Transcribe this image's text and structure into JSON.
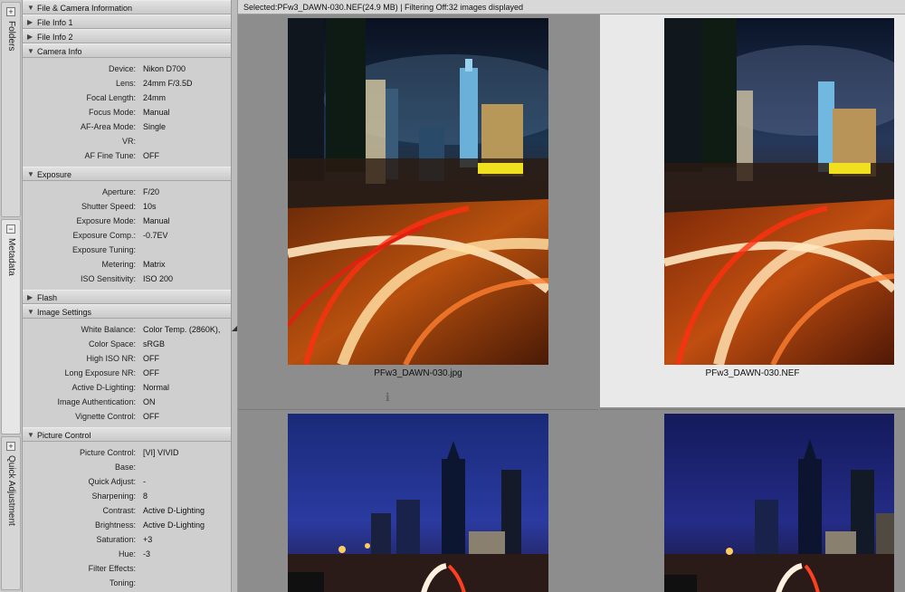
{
  "vtabs": {
    "folders": "Folders",
    "metadata": "Metadata",
    "quick_adjustment": "Quick Adjustment",
    "expand": "+",
    "collapse": "−"
  },
  "panel": {
    "file_camera": "File & Camera Information",
    "file_info_1": "File Info 1",
    "file_info_2": "File Info 2",
    "camera_info": {
      "title": "Camera Info",
      "rows": [
        {
          "k": "Device:",
          "v": "Nikon D700"
        },
        {
          "k": "Lens:",
          "v": "24mm F/3.5D"
        },
        {
          "k": "Focal Length:",
          "v": "24mm"
        },
        {
          "k": "Focus Mode:",
          "v": "Manual"
        },
        {
          "k": "AF-Area Mode:",
          "v": "Single"
        },
        {
          "k": "VR:",
          "v": ""
        },
        {
          "k": "AF Fine Tune:",
          "v": "OFF"
        }
      ]
    },
    "exposure": {
      "title": "Exposure",
      "rows": [
        {
          "k": "Aperture:",
          "v": "F/20"
        },
        {
          "k": "Shutter Speed:",
          "v": "10s"
        },
        {
          "k": "Exposure Mode:",
          "v": "Manual"
        },
        {
          "k": "Exposure Comp.:",
          "v": "-0.7EV"
        },
        {
          "k": "Exposure Tuning:",
          "v": ""
        },
        {
          "k": "Metering:",
          "v": "Matrix"
        },
        {
          "k": "ISO Sensitivity:",
          "v": "ISO 200"
        }
      ]
    },
    "flash": "Flash",
    "image_settings": {
      "title": "Image Settings",
      "rows": [
        {
          "k": "White Balance:",
          "v": "Color Temp. (2860K),"
        },
        {
          "k": "Color Space:",
          "v": "sRGB"
        },
        {
          "k": "High ISO NR:",
          "v": "OFF"
        },
        {
          "k": "Long Exposure NR:",
          "v": "OFF"
        },
        {
          "k": "Active D-Lighting:",
          "v": "Normal"
        },
        {
          "k": "Image Authentication:",
          "v": "ON"
        },
        {
          "k": "Vignette Control:",
          "v": "OFF"
        }
      ]
    },
    "picture_control": {
      "title": "Picture Control",
      "rows": [
        {
          "k": "Picture Control:",
          "v": "[VI] VIVID"
        },
        {
          "k": "Base:",
          "v": ""
        },
        {
          "k": "Quick Adjust:",
          "v": "-"
        },
        {
          "k": "Sharpening:",
          "v": "8"
        },
        {
          "k": "Contrast:",
          "v": "Active D-Lighting"
        },
        {
          "k": "Brightness:",
          "v": "Active D-Lighting"
        },
        {
          "k": "Saturation:",
          "v": "+3"
        },
        {
          "k": "Hue:",
          "v": "-3"
        },
        {
          "k": "Filter Effects:",
          "v": ""
        },
        {
          "k": "Toning:",
          "v": ""
        }
      ]
    }
  },
  "status": "Selected:PFw3_DAWN-030.NEF(24.9 MB) | Filtering Off:32 images displayed",
  "thumbnails": [
    {
      "name": "PFw3_DAWN-030.jpg"
    },
    {
      "name": "PFw3_DAWN-030.NEF"
    },
    {
      "name": ""
    },
    {
      "name": ""
    }
  ],
  "info_glyph": "i",
  "triangles": {
    "open": "▼",
    "closed": "▶"
  },
  "grip": "◢"
}
